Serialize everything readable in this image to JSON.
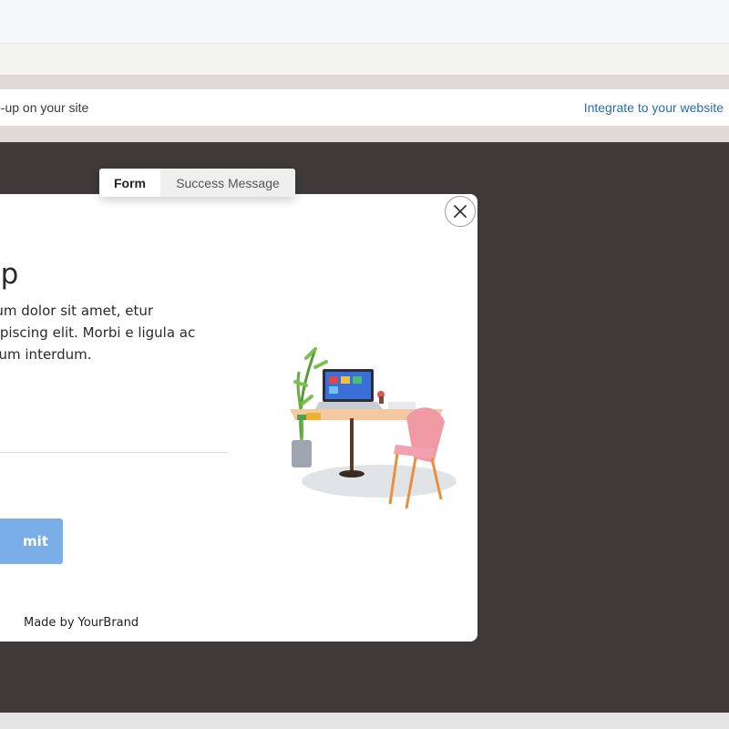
{
  "info_bar": {
    "text": "p-up on your site",
    "integrate_link": "Integrate to your website"
  },
  "tabs": {
    "form": "Form",
    "success": "Success Message"
  },
  "popup": {
    "heading": "n up",
    "description": "psum dolor sit amet, etur adipiscing elit. Morbi e ligula ac ipsum interdum.",
    "email_value": "",
    "submit_label": "mit",
    "made_by": "Made by YourBrand"
  },
  "icons": {
    "close": "close-icon",
    "illustration": "desk-workspace-illustration"
  },
  "colors": {
    "accent": "#7aaee6",
    "link": "#2b6cb0",
    "stage": "#3d3a39"
  }
}
